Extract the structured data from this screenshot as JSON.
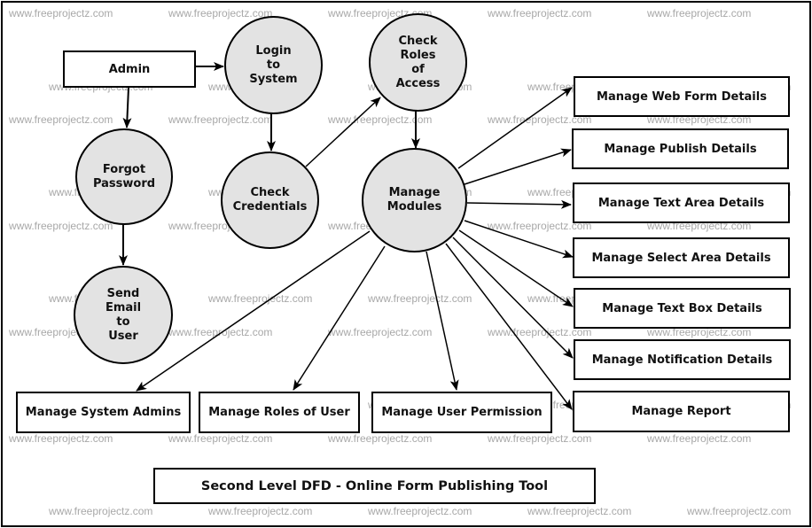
{
  "watermark": "www.freeprojectz.com",
  "colors": {
    "process_fill": "#e3e3e3",
    "stroke": "#000000",
    "watermark": "#a8a8a8"
  },
  "entities": {
    "admin": "Admin"
  },
  "processes": {
    "login": "Login\nto\nSystem",
    "check_roles": "Check\nRoles\nof\nAccess",
    "forgot_password": "Forgot\nPassword",
    "check_credentials": "Check\nCredentials",
    "manage_modules": "Manage\nModules",
    "send_email": "Send\nEmail\nto\nUser"
  },
  "modules_right": [
    "Manage Web Form Details",
    "Manage Publish Details",
    "Manage Text Area Details",
    "Manage Select Area Details",
    "Manage Text Box Details",
    "Manage Notification Details",
    "Manage Report"
  ],
  "modules_bottom": [
    "Manage System Admins",
    "Manage Roles of User",
    "Manage User Permission"
  ],
  "title": "Second Level DFD - Online Form Publishing Tool"
}
